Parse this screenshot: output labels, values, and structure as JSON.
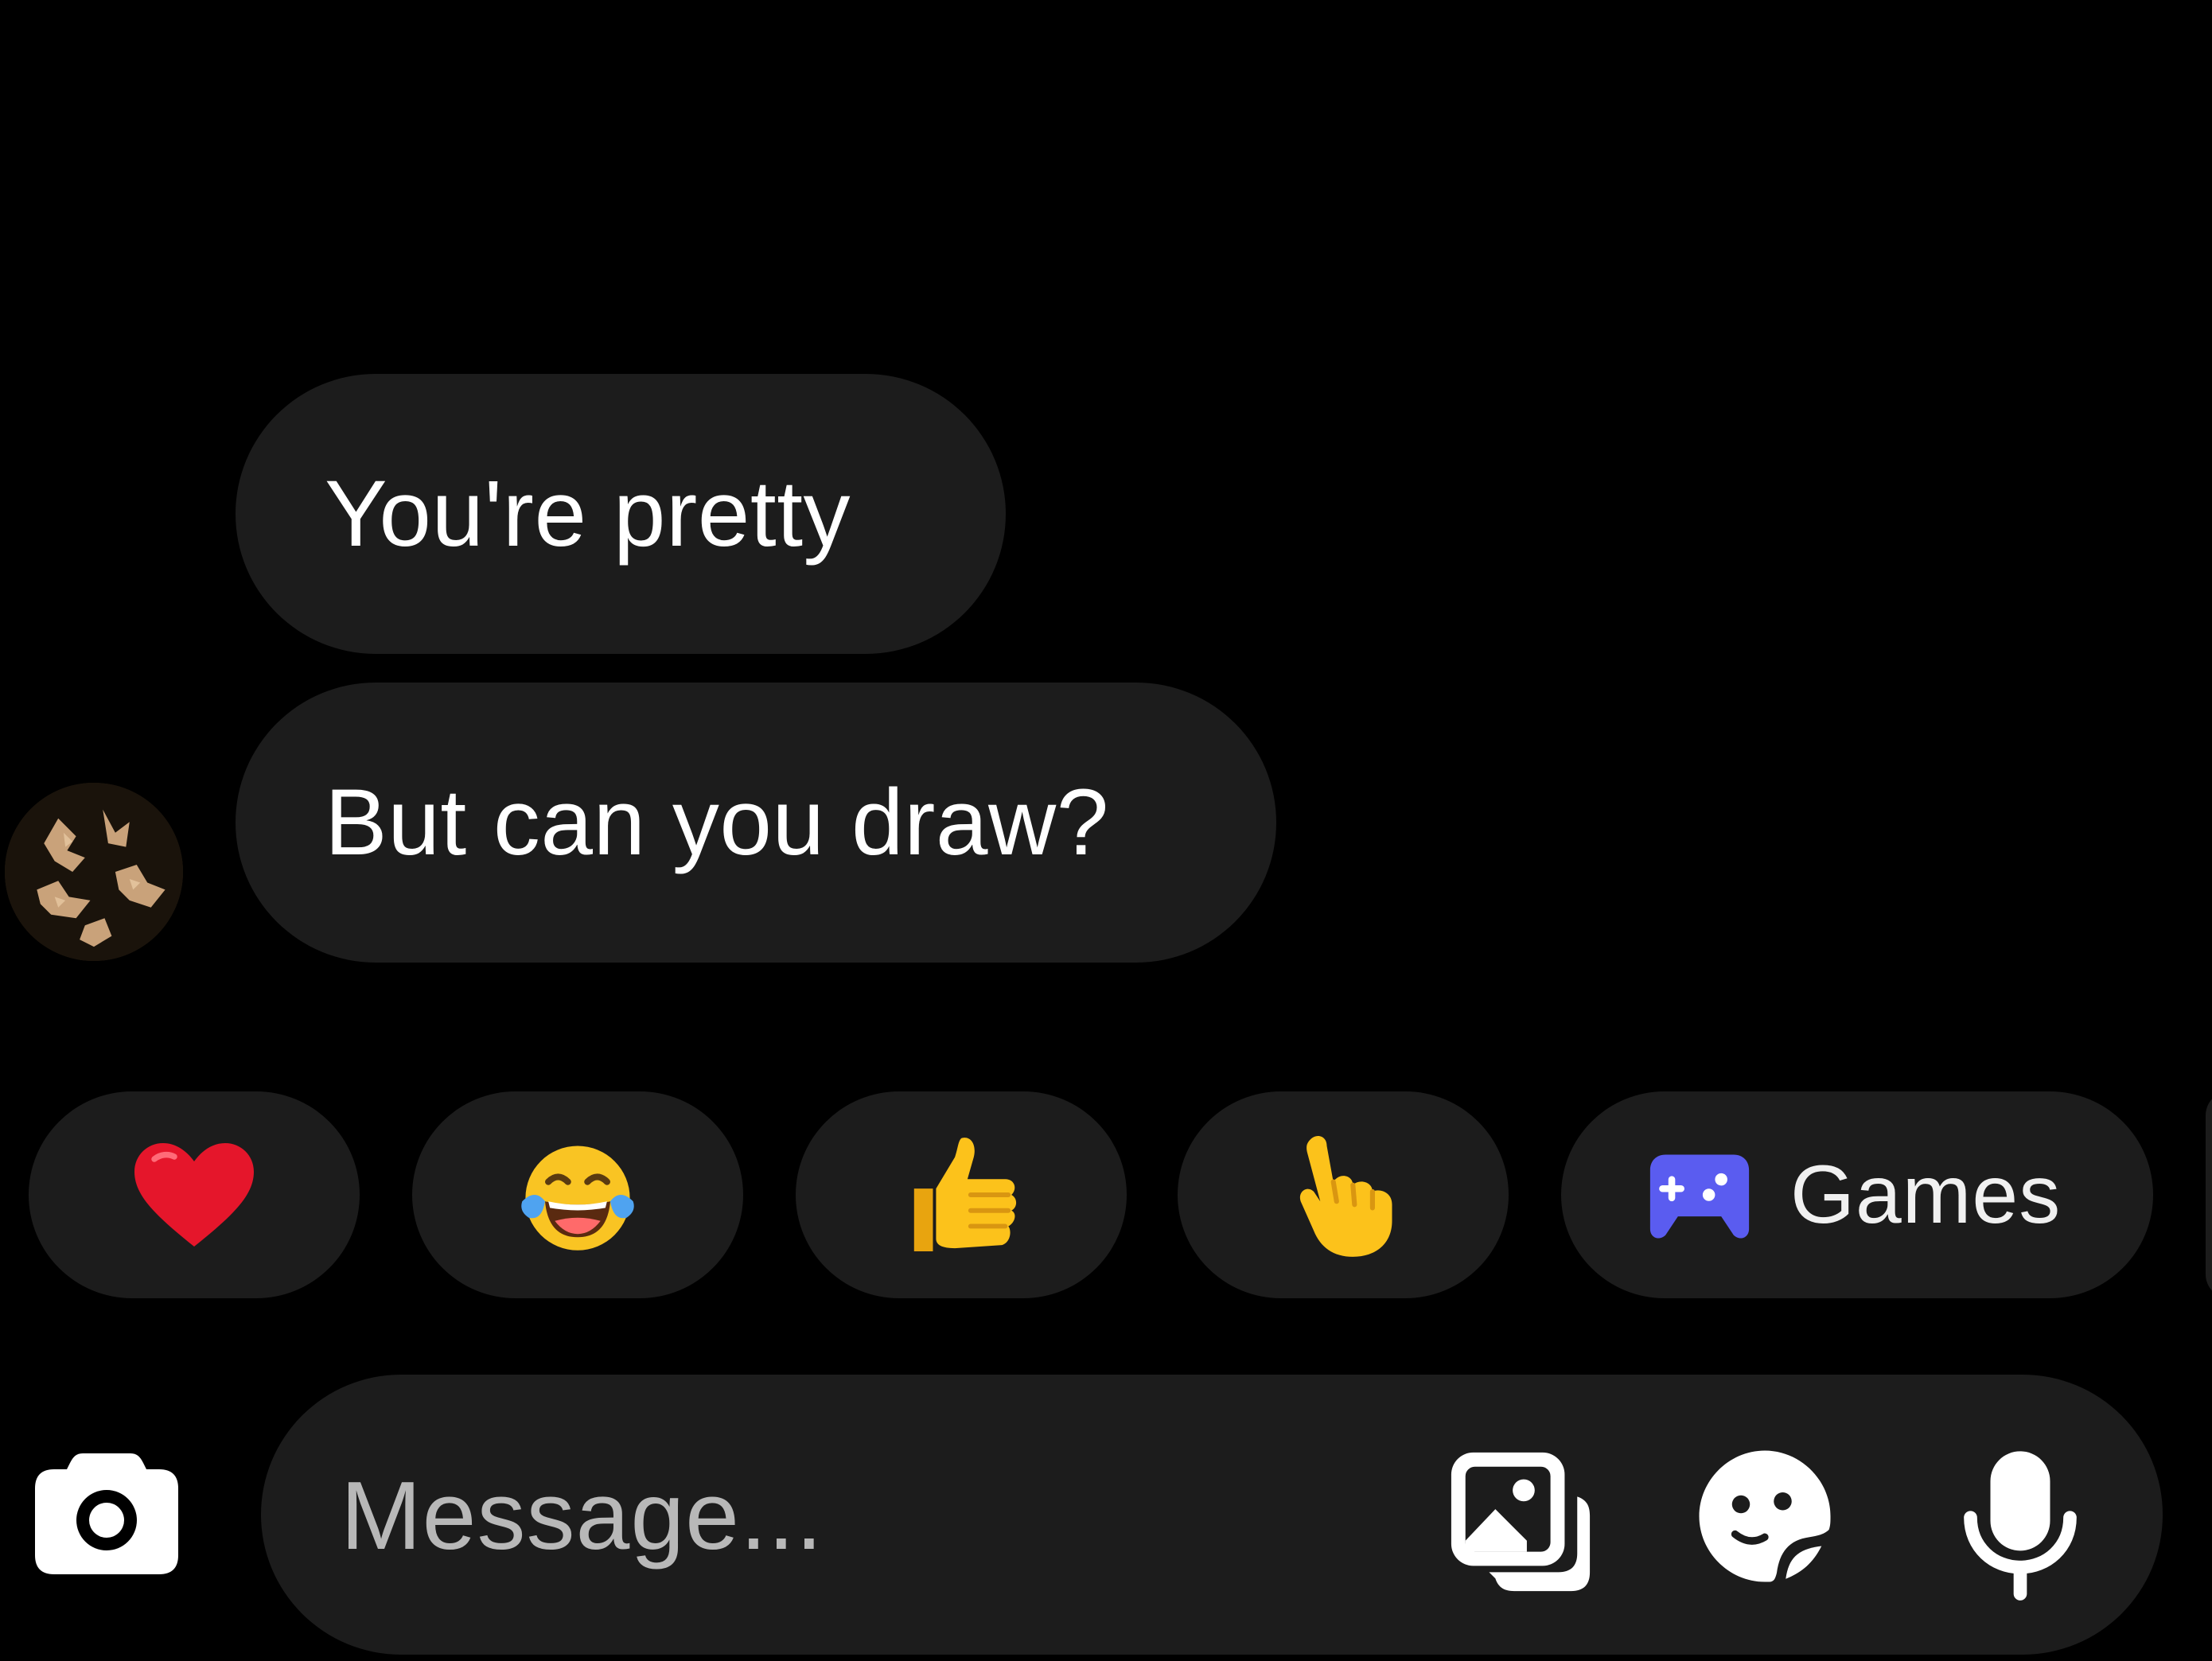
{
  "conversation": {
    "messages": [
      {
        "text": "You're pretty"
      },
      {
        "text": "But can you draw?"
      }
    ]
  },
  "quick_replies": [
    {
      "icon": "red-heart-icon"
    },
    {
      "icon": "face-with-tears-of-joy-icon"
    },
    {
      "icon": "thumbs-up-icon"
    },
    {
      "icon": "pointing-hand-icon"
    },
    {
      "icon": "gamepad-icon",
      "label": "Games"
    }
  ],
  "composer": {
    "placeholder": "Message..."
  },
  "colors": {
    "background": "#000000",
    "bubble": "#1c1c1c",
    "text": "#ffffff",
    "games_accent": "#5a5cf0"
  }
}
